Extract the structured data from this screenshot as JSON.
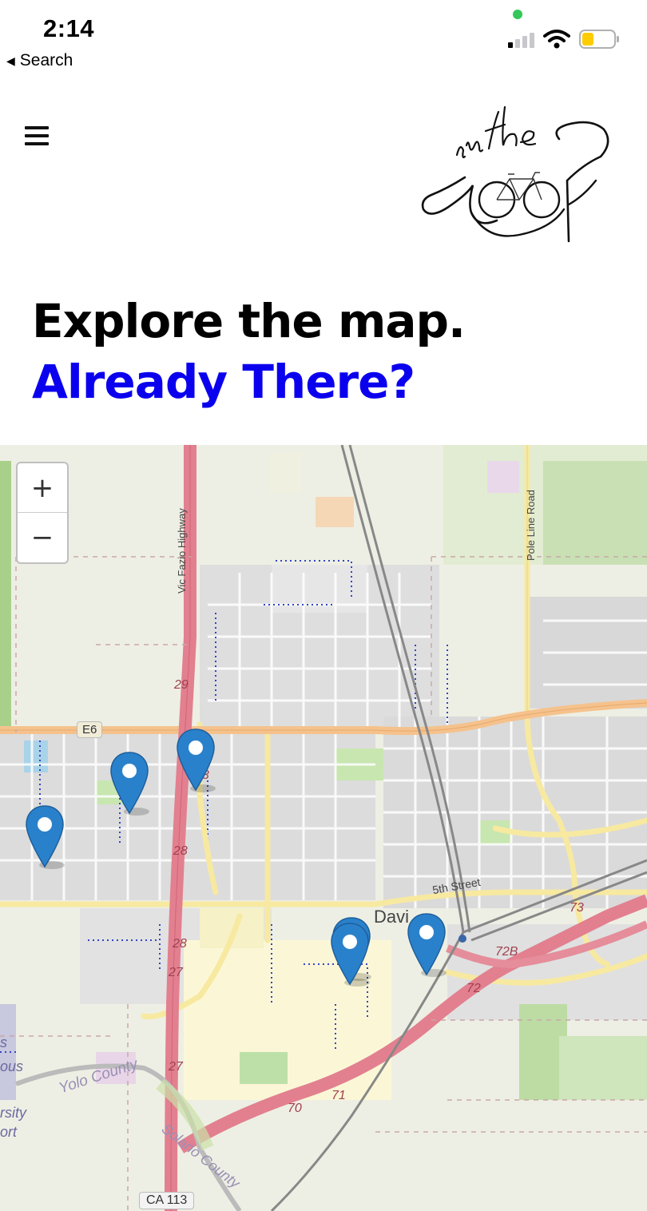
{
  "status_bar": {
    "time": "2:14",
    "back_label": "Search",
    "back_icon": "triangle-left-icon"
  },
  "header": {
    "menu_icon": "hamburger-icon",
    "logo_text": "in the Loop"
  },
  "hero": {
    "headline": "Explore the map.",
    "subheadline": "Already There?",
    "subheadline_color": "#0a00ee"
  },
  "map": {
    "zoom_in_label": "+",
    "zoom_out_label": "−",
    "road_labels": {
      "vic_fazio": "Vic Fazio Highway",
      "pole_line": "Pole Line Road",
      "e6": "E6",
      "fifth_street": "5th Street",
      "ca113": "CA 113",
      "yolo": "Yolo County",
      "solano": "Solano County",
      "davis": "Davi",
      "exit_29": "29",
      "exit_28a": "28",
      "exit_28b": "28",
      "exit_27a": "27",
      "exit_27b": "27",
      "exit_23": "23",
      "exit_73": "73",
      "exit_72b": "72B",
      "exit_72": "72",
      "exit_71": "71",
      "exit_70": "70",
      "edge_s": "s",
      "edge_ous": "ous",
      "edge_rsity": "rsity",
      "edge_ort": "ort"
    },
    "marker_color": "#2a81cb",
    "marker_count": 6
  }
}
